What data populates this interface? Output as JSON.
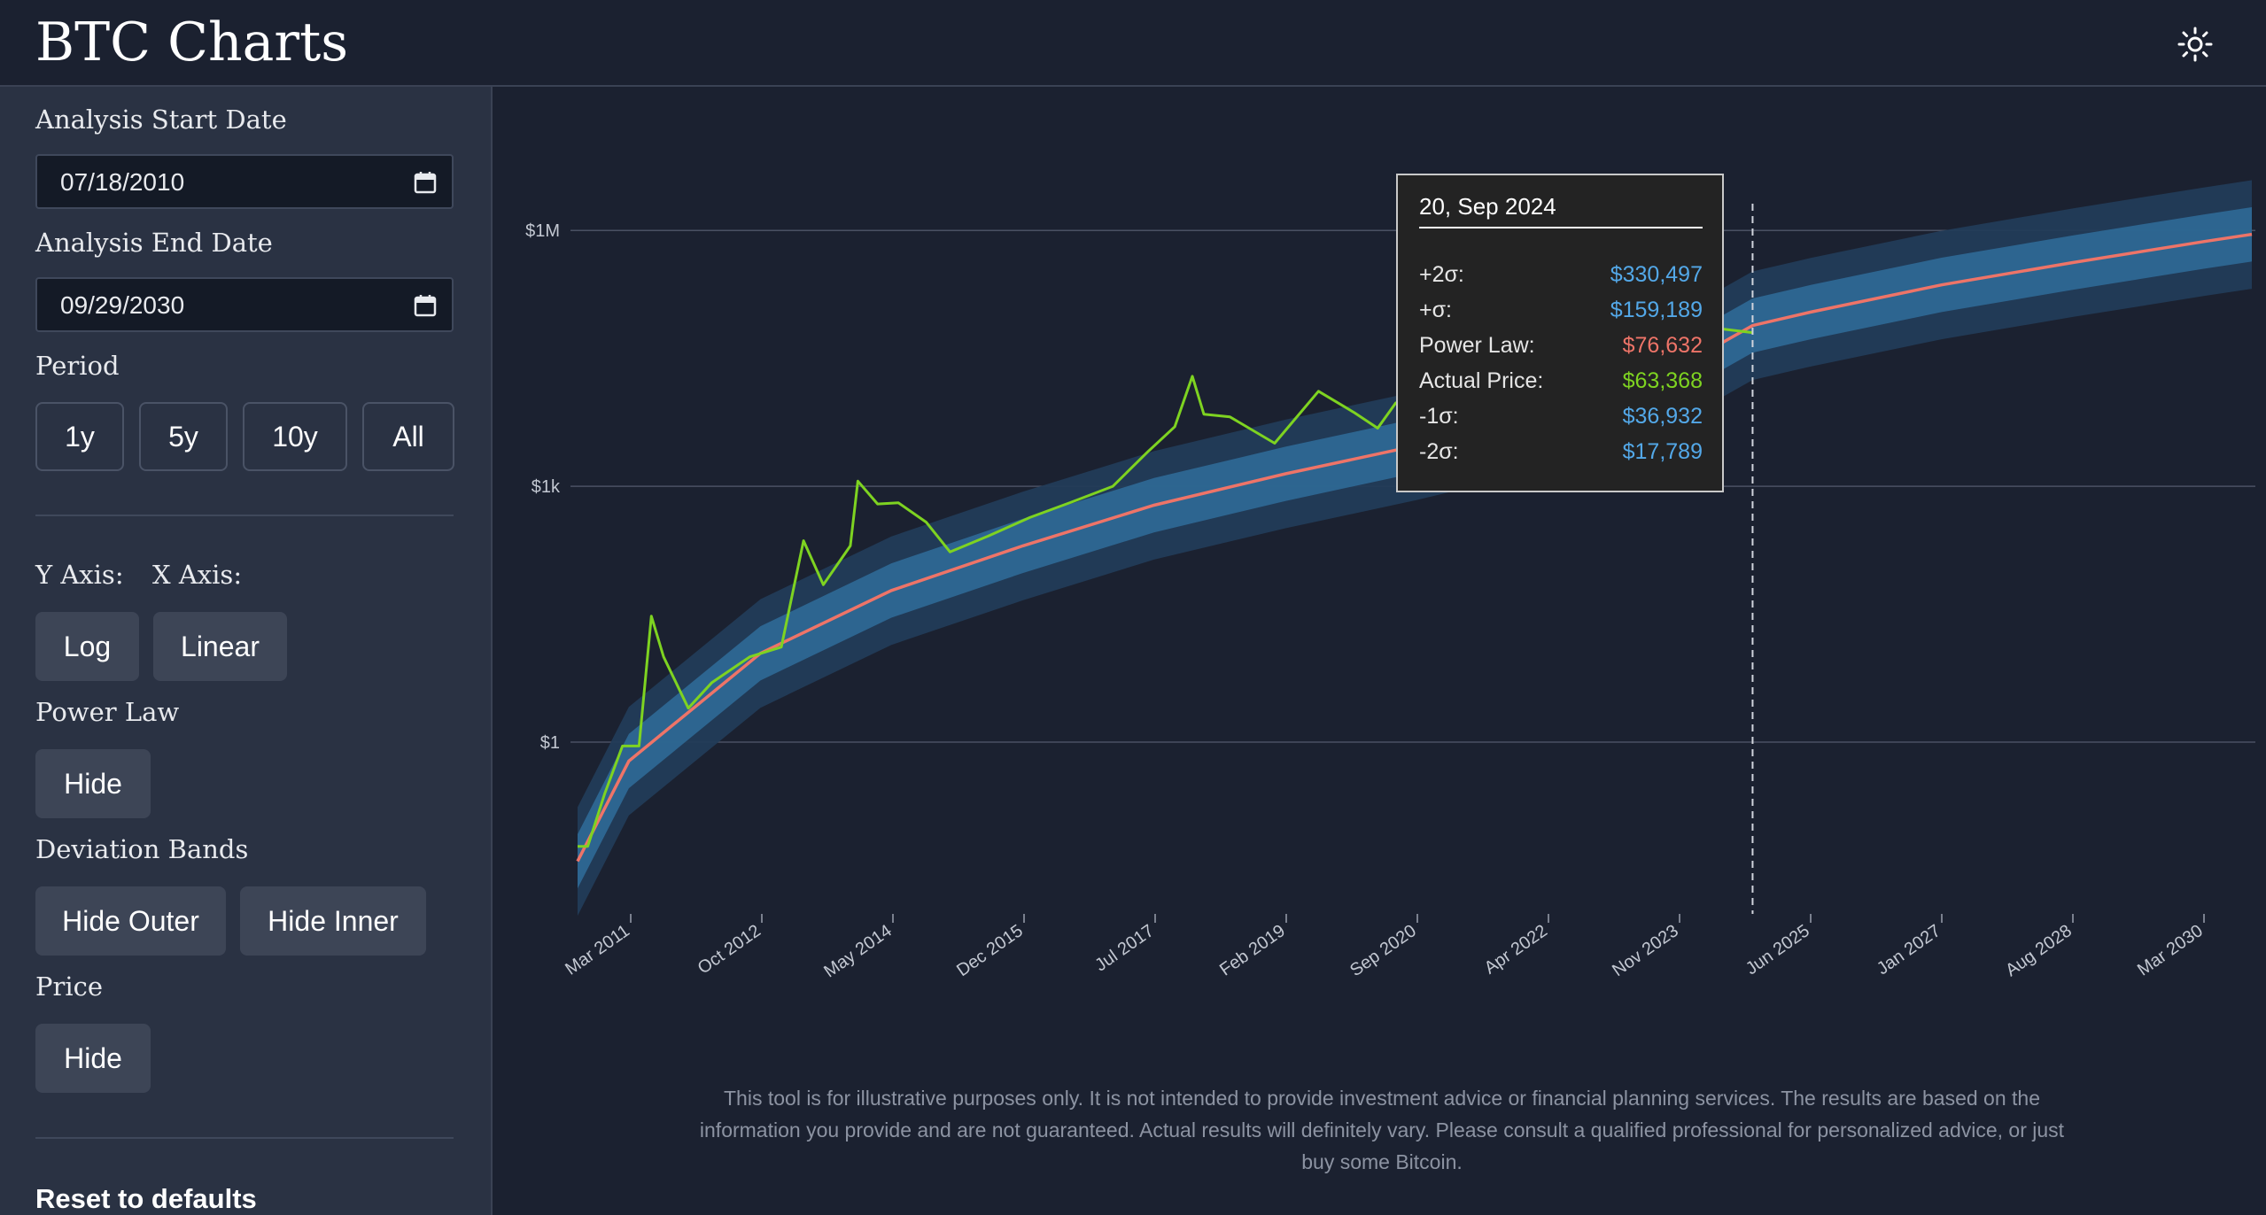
{
  "header": {
    "title": "BTC Charts",
    "theme_icon": "sun-icon"
  },
  "sidebar": {
    "start_label": "Analysis Start Date",
    "start_value": "07/18/2010",
    "end_label": "Analysis End Date",
    "end_value": "09/29/2030",
    "period_label": "Period",
    "period_buttons": [
      "1y",
      "5y",
      "10y",
      "All"
    ],
    "y_axis_label": "Y Axis:",
    "x_axis_label": "X Axis:",
    "y_axis_button": "Log",
    "x_axis_button": "Linear",
    "power_law_label": "Power Law",
    "power_law_button": "Hide",
    "bands_label": "Deviation Bands",
    "hide_outer_button": "Hide Outer",
    "hide_inner_button": "Hide Inner",
    "price_label": "Price",
    "price_button": "Hide",
    "reset_label": "Reset to defaults"
  },
  "colors": {
    "power_law": "#ee7468",
    "price": "#7ed321",
    "inner_band": "#2f6a97",
    "outer_band": "#223c59",
    "sigma_text": "#53a8e8",
    "background": "#1b2130",
    "sidebar": "#2a3243"
  },
  "chart_data": {
    "type": "line",
    "y_scale": "log",
    "x_scale": "linear (time)",
    "y_ticks": [
      "$1",
      "$1k",
      "$1M"
    ],
    "y_tick_values": [
      1,
      1000,
      1000000
    ],
    "x_ticks": [
      "Mar 2011",
      "Oct 2012",
      "May 2014",
      "Dec 2015",
      "Jul 2017",
      "Feb 2019",
      "Sep 2020",
      "Apr 2022",
      "Nov 2023",
      "Jun 2025",
      "Jan 2027",
      "Aug 2028",
      "Mar 2030"
    ],
    "x_range": [
      "2010-07-18",
      "2030-09-29"
    ],
    "hover_date": "2024-09-20",
    "power_law": {
      "x": [
        "2010-07-18",
        "2011-03-01",
        "2012-10-01",
        "2014-05-01",
        "2015-12-01",
        "2017-07-01",
        "2019-02-01",
        "2020-09-01",
        "2022-04-01",
        "2023-11-01",
        "2024-09-20",
        "2025-06-01",
        "2027-01-01",
        "2028-08-01",
        "2030-03-01",
        "2030-09-29"
      ],
      "values": [
        0.04,
        0.6,
        11,
        60,
        200,
        600,
        1400,
        3000,
        7000,
        25000,
        76632,
        110000,
        230000,
        420000,
        740000,
        900000
      ]
    },
    "deviation_bands": {
      "plus_2_sigma_factor": 4.31,
      "plus_1_sigma_factor": 2.08,
      "minus_1_sigma_factor": 0.48,
      "minus_2_sigma_factor": 0.23
    },
    "actual_price": {
      "x": [
        "2010-07-18",
        "2010-09-01",
        "2010-11-15",
        "2011-02-01",
        "2011-04-15",
        "2011-06-08",
        "2011-08-01",
        "2011-11-18",
        "2012-03-01",
        "2012-08-15",
        "2013-01-01",
        "2013-04-09",
        "2013-07-05",
        "2013-11-01",
        "2013-12-04",
        "2014-03-01",
        "2014-06-01",
        "2014-10-01",
        "2015-01-14",
        "2015-07-01",
        "2016-01-01",
        "2016-07-01",
        "2017-01-01",
        "2017-06-01",
        "2017-10-01",
        "2017-12-17",
        "2018-02-06",
        "2018-06-01",
        "2018-12-15",
        "2019-06-26",
        "2019-12-01",
        "2020-03-13",
        "2020-06-01",
        "2020-09-01",
        "2020-12-01",
        "2021-04-14",
        "2021-07-20",
        "2021-11-10",
        "2022-06-18",
        "2022-11-21",
        "2023-06-01",
        "2024-01-01",
        "2024-03-14",
        "2024-09-20"
      ],
      "values": [
        0.06,
        0.06,
        0.25,
        0.9,
        0.9,
        30,
        10,
        2.5,
        5,
        10,
        13,
        230,
        70,
        200,
        1150,
        620,
        640,
        380,
        170,
        260,
        430,
        650,
        1000,
        2500,
        5000,
        19500,
        7000,
        6500,
        3200,
        13000,
        7300,
        4800,
        9500,
        11000,
        19000,
        63000,
        29800,
        68000,
        19000,
        15700,
        27000,
        42500,
        73000,
        63368
      ]
    },
    "tooltip": {
      "date": "20, Sep 2024",
      "rows": [
        {
          "label": "+2σ:",
          "value": "$330,497",
          "color": "#53a8e8"
        },
        {
          "label": "+σ:",
          "value": "$159,189",
          "color": "#53a8e8"
        },
        {
          "label": "Power Law:",
          "value": "$76,632",
          "color": "#ee7468"
        },
        {
          "label": "Actual Price:",
          "value": "$63,368",
          "color": "#7ed321"
        },
        {
          "label": "-1σ:",
          "value": "$36,932",
          "color": "#53a8e8"
        },
        {
          "label": "-2σ:",
          "value": "$17,789",
          "color": "#53a8e8"
        }
      ]
    }
  },
  "disclaimer": "This tool is for illustrative purposes only. It is not intended to provide investment advice or financial planning services. The results are based on the information you provide and are not guaranteed. Actual results will definitely vary. Please consult a qualified professional for personalized advice, or just buy some Bitcoin."
}
